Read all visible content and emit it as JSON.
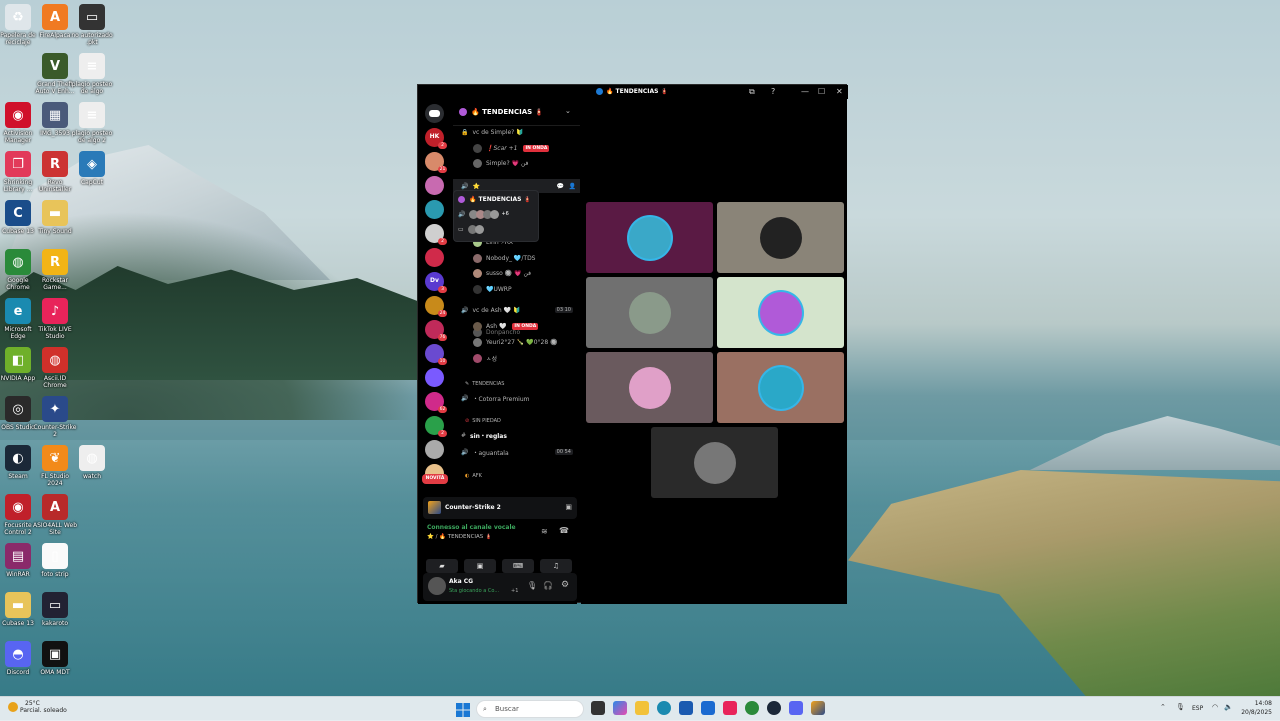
{
  "desktop_icons": [
    {
      "label": "Papelera de reciclaje",
      "col": 0,
      "row": 0,
      "color": "#dfe6ea",
      "glyph": "♻"
    },
    {
      "label": "FireAlpaca",
      "col": 1,
      "row": 0,
      "color": "#f07a22",
      "glyph": "A"
    },
    {
      "label": "no autorizado .pkt",
      "col": 2,
      "row": 0,
      "color": "#333",
      "glyph": "▭"
    },
    {
      "label": "Grand Theft Auto V Enh...",
      "col": 1,
      "row": 1,
      "color": "#3a5a2a",
      "glyph": "V"
    },
    {
      "label": "plagio posteo de algo",
      "col": 2,
      "row": 1,
      "color": "#eee",
      "glyph": "≡"
    },
    {
      "label": "Activision Manager",
      "col": 0,
      "row": 2,
      "color": "#d0102a",
      "glyph": "◉"
    },
    {
      "label": "IMG_3593",
      "col": 1,
      "row": 2,
      "color": "#4a5a7a",
      "glyph": "▦"
    },
    {
      "label": "plagio posteo de algo 2",
      "col": 2,
      "row": 2,
      "color": "#eee",
      "glyph": "≡"
    },
    {
      "label": "Shrinking Library ...",
      "col": 0,
      "row": 3,
      "color": "#e23a5a",
      "glyph": "❐"
    },
    {
      "label": "Revo Uninstaller",
      "col": 1,
      "row": 3,
      "color": "#c33",
      "glyph": "R"
    },
    {
      "label": "CapCut",
      "col": 2,
      "row": 3,
      "color": "#2a7ab8",
      "glyph": "◈"
    },
    {
      "label": "Cubase 13",
      "col": 0,
      "row": 4,
      "color": "#1a4d8a",
      "glyph": "C"
    },
    {
      "label": "Tiny Sound",
      "col": 1,
      "row": 4,
      "color": "#e8c45a",
      "glyph": "▬"
    },
    {
      "label": "Google Chrome",
      "col": 0,
      "row": 5,
      "color": "#2a8a3a",
      "glyph": "◍"
    },
    {
      "label": "Rockstar Game...",
      "col": 1,
      "row": 5,
      "color": "#f2b416",
      "glyph": "R"
    },
    {
      "label": "Microsoft Edge",
      "col": 0,
      "row": 6,
      "color": "#1a8ab0",
      "glyph": "e"
    },
    {
      "label": "TikTok LIVE Studio",
      "col": 1,
      "row": 6,
      "color": "#e8245a",
      "glyph": "♪"
    },
    {
      "label": "NVIDIA App",
      "col": 0,
      "row": 7,
      "color": "#6fb02a",
      "glyph": "◧"
    },
    {
      "label": "Ascii.ID Chrome",
      "col": 1,
      "row": 7,
      "color": "#d0302a",
      "glyph": "◍"
    },
    {
      "label": "OBS Studio",
      "col": 0,
      "row": 8,
      "color": "#2a2a2a",
      "glyph": "◎"
    },
    {
      "label": "Counter-Strike 2",
      "col": 1,
      "row": 8,
      "color": "#2a4a8a",
      "glyph": "✦"
    },
    {
      "label": "Steam",
      "col": 0,
      "row": 9,
      "color": "#1b2838",
      "glyph": "◐"
    },
    {
      "label": "FL Studio 2024",
      "col": 1,
      "row": 9,
      "color": "#f28a1a",
      "glyph": "❦"
    },
    {
      "label": "watch",
      "col": 2,
      "row": 9,
      "color": "#eee",
      "glyph": "◍"
    },
    {
      "label": "Focusrite Control 2",
      "col": 0,
      "row": 10,
      "color": "#c0202a",
      "glyph": "◉"
    },
    {
      "label": "ASIO4ALL Web Site",
      "col": 1,
      "row": 10,
      "color": "#b82a2a",
      "glyph": "A"
    },
    {
      "label": "WinRAR",
      "col": 0,
      "row": 11,
      "color": "#8a2a6a",
      "glyph": "▤"
    },
    {
      "label": "foto strip",
      "col": 1,
      "row": 11,
      "color": "#fafafa",
      "glyph": "▯"
    },
    {
      "label": "Cubase 13",
      "col": 0,
      "row": 12,
      "color": "#e8c45a",
      "glyph": "▬"
    },
    {
      "label": "kakaroto",
      "col": 1,
      "row": 12,
      "color": "#223",
      "glyph": "▭"
    },
    {
      "label": "Discord",
      "col": 0,
      "row": 13,
      "color": "#5865f2",
      "glyph": "◓"
    },
    {
      "label": "OMA MDT",
      "col": 1,
      "row": 13,
      "color": "#111",
      "glyph": "▣"
    }
  ],
  "window": {
    "title": "🔥 TENDENCIAS 🧯",
    "controls": [
      "⧉",
      "?",
      "—",
      "☐",
      "✕"
    ]
  },
  "servers": [
    {
      "color": "#c0202a",
      "badge": "2",
      "letters": "HK"
    },
    {
      "color": "#d88a6a",
      "badge": "21",
      "letters": ""
    },
    {
      "color": "#c86ab0",
      "badge": "",
      "letters": ""
    },
    {
      "color": "#2a9ab0",
      "badge": "",
      "letters": ""
    },
    {
      "color": "#cfcfcf",
      "badge": "2",
      "letters": ""
    },
    {
      "color": "#d02a4a",
      "badge": "",
      "letters": ""
    },
    {
      "color": "#5a3ad0",
      "badge": "3",
      "letters": "Dv"
    },
    {
      "color": "#c88a1a",
      "badge": "24",
      "letters": ""
    },
    {
      "color": "#c02a5a",
      "badge": "76",
      "letters": ""
    },
    {
      "color": "#6a4ad0",
      "badge": "10",
      "letters": ""
    },
    {
      "color": "#7a5aff",
      "badge": "",
      "letters": ""
    },
    {
      "color": "#d02a8a",
      "badge": "62",
      "letters": ""
    },
    {
      "color": "#2aa04a",
      "badge": "2",
      "letters": ""
    },
    {
      "color": "#aaaaaa",
      "badge": "",
      "letters": ""
    },
    {
      "color": "#e8c08a",
      "badge": "",
      "letters": ""
    }
  ],
  "novita_label": "NOVITÀ",
  "channels": {
    "server_name": "🔥 TENDENCIAS 🧯",
    "vc_simple": "vc de Simple? 🔰",
    "user_scar": "❗Scar +1",
    "in_onda": "IN ONDA",
    "user_simple": "Simple? 💗 فن",
    "star_channel": "⭐",
    "hover_title": "🔥 TENDENCIAS 🧯",
    "hover_more": "+6",
    "user_donpancho": "Donpancho",
    "user_linn": "Linn ⚡RX",
    "user_nobody": "Nobody_ 🩵/TDS",
    "user_susso": "susso 🔘 💗 فن",
    "user_uwrp": "🩵UWRP",
    "vc_ash": "vc de Ash 🤍 🔰",
    "vc_ash_count": "03 10",
    "user_ash": "Ash 🤍",
    "user_yeuri": "Yeuri2°27 🍾 💚0°28 🔘",
    "user_sdg": "ㅅ성",
    "cat_tendencias": "TENDENCIAS",
    "ch_cotorra": "・Cotorra Premium",
    "cat_sin_piedad": "SIN PIEDAD",
    "ch_sin_reglas": "sin・reglas",
    "ch_aguantala": "・aguantala",
    "aguantala_count": "00 54",
    "cat_afk": "AFK"
  },
  "activity": {
    "game": "Counter-Strike 2"
  },
  "voice": {
    "status": "Connesso al canale vocale",
    "channel": "⭐ / 🔥 TENDENCIAS 🧯"
  },
  "user": {
    "name": "Aka CG",
    "status": "Sta giocando a Co...",
    "extra": "+1"
  },
  "tiles": [
    {
      "bg": "#5a1a44",
      "pic": "#3aa8c8",
      "ring": true
    },
    {
      "bg": "#8a8478",
      "pic": "#222",
      "ring": false
    },
    {
      "bg": "#707070",
      "pic": "#8a9a8a",
      "ring": false
    },
    {
      "bg": "#d4e4cc",
      "pic": "#b05ad8",
      "ring": true
    },
    {
      "bg": "#6a5a5e",
      "pic": "#e0a0c8",
      "ring": false
    },
    {
      "bg": "#9a7062",
      "pic": "#2aa8c8",
      "ring": true
    },
    {
      "bg": "#2a2a2a",
      "pic": "#777",
      "ring": false
    }
  ],
  "taskbar": {
    "weather_temp": "25°C",
    "weather_desc": "Parcial. soleado",
    "search": "Buscar",
    "lang": "ESP",
    "time": "14:08",
    "date": "20/8/2025"
  }
}
